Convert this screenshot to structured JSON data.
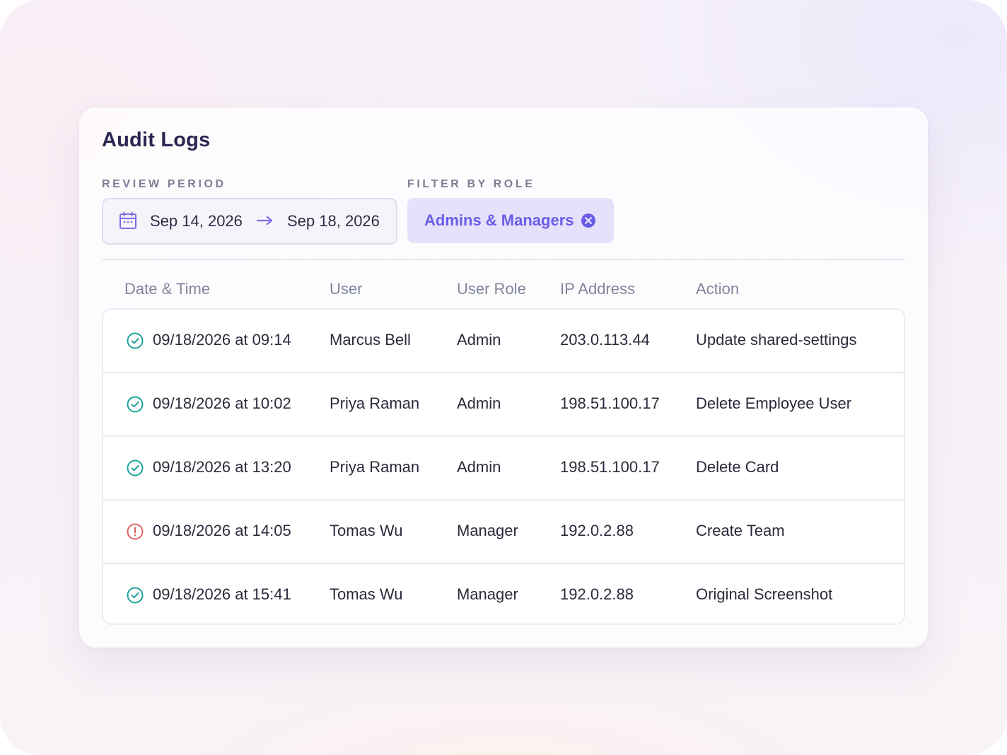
{
  "page": {
    "title": "Audit Logs"
  },
  "filters": {
    "review_period_label": "REVIEW PERIOD",
    "start_date": "Sep 14, 2026",
    "end_date": "Sep 18, 2026",
    "calendar_icon": "calendar-icon",
    "arrow_icon": "arrow-right-icon",
    "role_label": "FILTER BY ROLE",
    "role_chip": "Admins & Managers",
    "clear_icon": "close-circle-icon"
  },
  "table": {
    "headers": [
      "Date & Time",
      "User",
      "User Role",
      "IP Address",
      "Action"
    ],
    "rows": [
      {
        "status": "success",
        "datetime": "09/18/2026 at 09:14",
        "user": "Marcus Bell",
        "role": "Admin",
        "ip": "203.0.113.44",
        "action": "Update shared-settings"
      },
      {
        "status": "success",
        "datetime": "09/18/2026 at 10:02",
        "user": "Priya Raman",
        "role": "Admin",
        "ip": "198.51.100.17",
        "action": "Delete Employee User"
      },
      {
        "status": "success",
        "datetime": "09/18/2026 at 13:20",
        "user": "Priya Raman",
        "role": "Admin",
        "ip": "198.51.100.17",
        "action": "Delete Card"
      },
      {
        "status": "warning",
        "datetime": "09/18/2026 at 14:05",
        "user": "Tomas Wu",
        "role": "Manager",
        "ip": "192.0.2.88",
        "action": "Create Team"
      },
      {
        "status": "success",
        "datetime": "09/18/2026 at 15:41",
        "user": "Tomas Wu",
        "role": "Manager",
        "ip": "192.0.2.88",
        "action": "Original Screenshot"
      }
    ]
  },
  "colors": {
    "accent": "#6a5ce6",
    "success": "#1aa39a",
    "warning": "#e06565",
    "title": "#2a2650"
  }
}
